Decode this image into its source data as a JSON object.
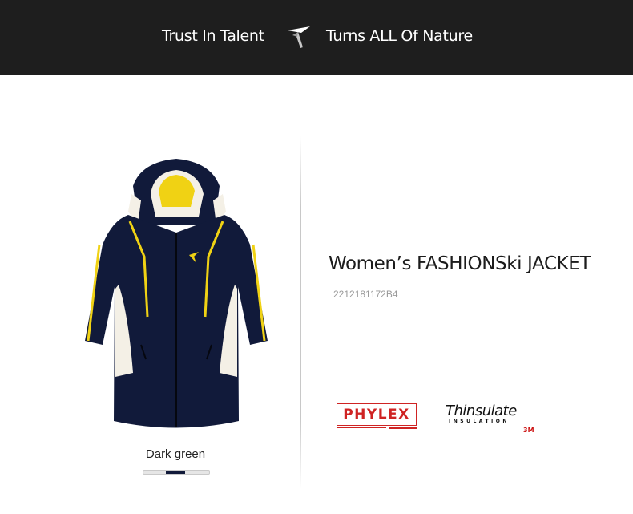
{
  "banner": {
    "left_text": "Trust In Talent",
    "right_text": "Turns ALL Of Nature",
    "logo_icon": "bird-logo-icon",
    "background": "#1e1e1e"
  },
  "product": {
    "image_icon": "ski-jacket-image",
    "color_label": "Dark green",
    "title": "Women’s FASHIONSki JACKET",
    "code": "2212181172B4"
  },
  "brands": {
    "phylex": {
      "logo_text": "PHYLEX",
      "brand_color": "#cf2323"
    },
    "thinsulate": {
      "logo_text": "Thinsulate",
      "sub_text": "INSULATION",
      "mark": "3M",
      "mark_color": "#cc1111"
    }
  },
  "colors": {
    "jacket_navy": "#111a3a",
    "accent_yellow": "#f0d214"
  }
}
